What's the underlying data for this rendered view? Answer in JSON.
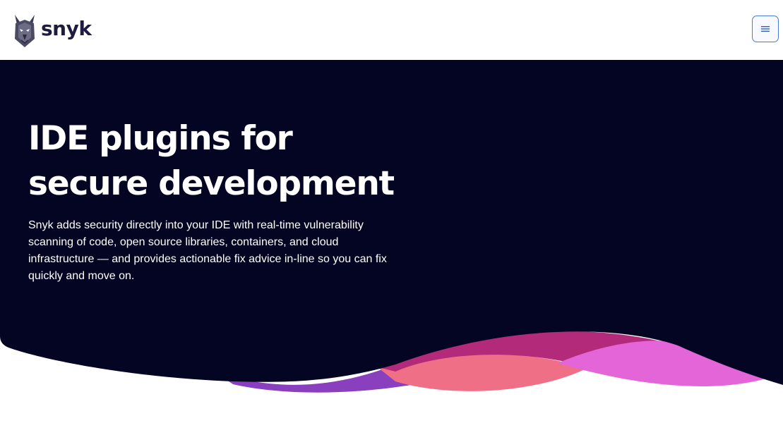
{
  "header": {
    "logo_text": "snyk",
    "menu_icon": "hamburger-menu-icon"
  },
  "hero": {
    "title_line1": "IDE plugins for",
    "title_line2": "secure development",
    "description": "Snyk adds security directly into your IDE with real-time vulnerability scanning of code, open source libraries, containers, and cloud infrastructure — and provides actionable fix advice in-line so you can fix quickly and move on."
  },
  "colors": {
    "hero_background": "#030522",
    "wave_purple": "#8a3fbf",
    "wave_coral": "#ef6f86",
    "wave_magenta": "#b42a7a",
    "wave_pink": "#e465d8",
    "logo_text": "#1d1b3f",
    "menu_border": "#4b79d6"
  }
}
